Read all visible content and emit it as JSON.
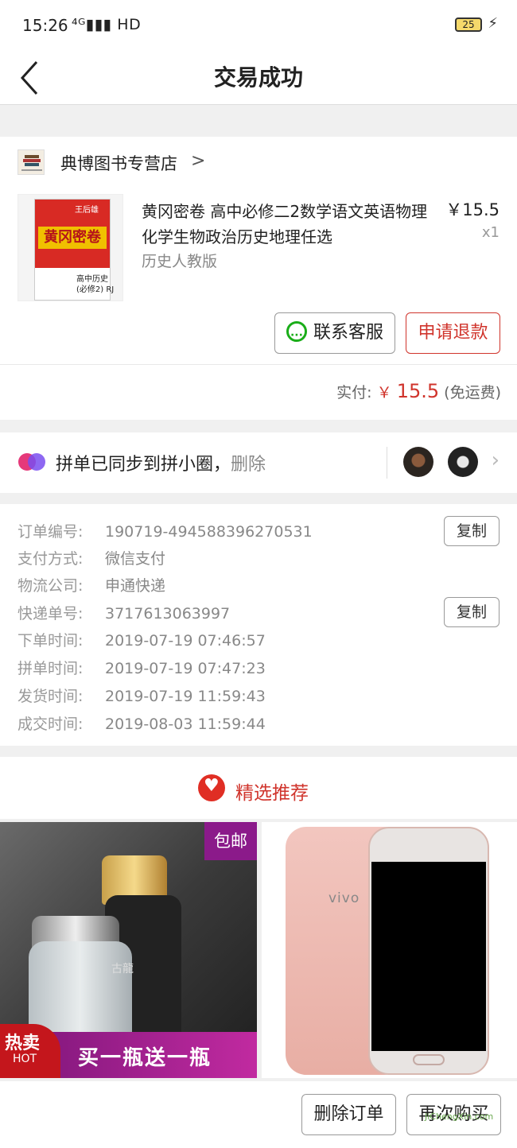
{
  "status_bar": {
    "time": "15:26",
    "network": "⁴ᴳ▮▮▮ HD",
    "battery": "25",
    "bolt": "⚡"
  },
  "nav": {
    "title": "交易成功"
  },
  "store": {
    "name": "典博图书专营店",
    "arrow": ">"
  },
  "product": {
    "title": "黄冈密卷 高中必修二2数学语文英语物理化学生物政治历史地理任选",
    "variant": "历史人教版",
    "price": "￥15.5",
    "quantity": "x1",
    "cover_title": "黄冈密卷",
    "cover_author": "王后雄",
    "cover_sub": "高中历史\n(必修2) RJ"
  },
  "actions": {
    "contact_service": "联系客服",
    "request_refund": "申请退款"
  },
  "payment": {
    "label": "实付:",
    "currency": "￥",
    "amount": "15.5",
    "note": "(免运费)"
  },
  "group": {
    "text": "拼单已同步到拼小圈，",
    "delete": "删除"
  },
  "order_info": [
    {
      "label": "订单编号:",
      "value": "190719-494588396270531",
      "copy": "复制"
    },
    {
      "label": "支付方式:",
      "value": "微信支付"
    },
    {
      "label": "物流公司:",
      "value": "申通快递"
    },
    {
      "label": "快递单号:",
      "value": "3717613063997",
      "copy": "复制"
    },
    {
      "label": "下单时间:",
      "value": "2019-07-19 07:46:57"
    },
    {
      "label": "拼单时间:",
      "value": "2019-07-19 07:47:23"
    },
    {
      "label": "发货时间:",
      "value": "2019-07-19 11:59:43"
    },
    {
      "label": "成交时间:",
      "value": "2019-08-03 11:59:44"
    }
  ],
  "recommend": {
    "title": "精选推荐",
    "perfume": {
      "badge": "包邮",
      "bottle_text": "古龍",
      "hot": "热卖",
      "hot_sub": "HOT",
      "banner": "买一瓶送一瓶"
    },
    "phone": {
      "brand": "vivo"
    }
  },
  "bottom_actions": {
    "delete_order": "删除订单",
    "buy_again": "再次购买"
  },
  "watermark": "JiChengXin.com",
  "colors": {
    "accent_red": "#d0342c",
    "wechat_green": "#1aad19"
  }
}
